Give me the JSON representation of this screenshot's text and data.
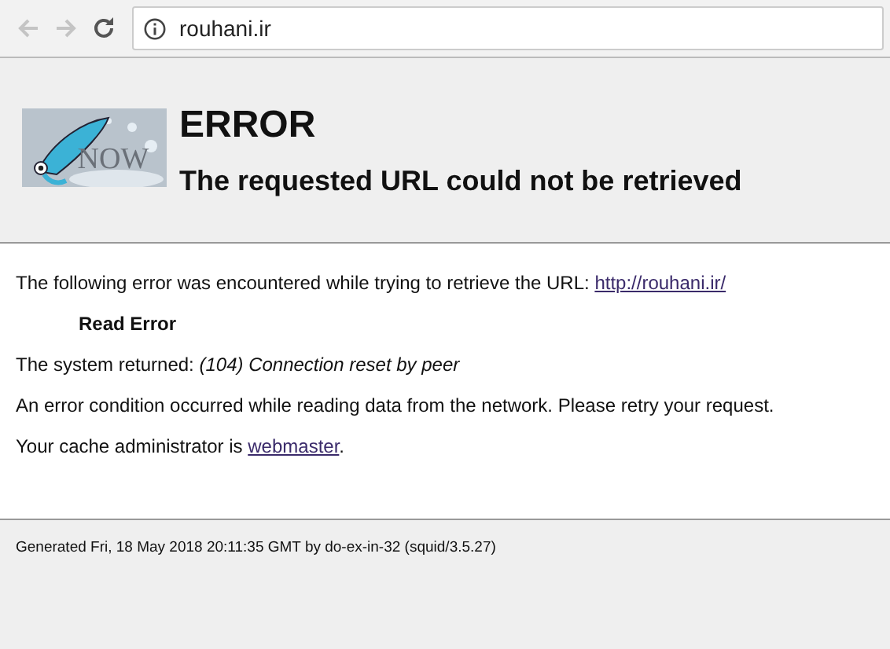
{
  "browser": {
    "nav_buttons": [
      {
        "kind": "back",
        "disabled": true
      },
      {
        "kind": "forward",
        "disabled": true
      },
      {
        "kind": "reload",
        "disabled": false
      }
    ],
    "address": "rouhani.ir"
  },
  "header": {
    "logo_text": "NOW",
    "title": "ERROR",
    "subtitle": "The requested URL could not be retrieved"
  },
  "body": [
    {
      "kind": "text",
      "text": "The following error was encountered while trying to retrieve the URL: ",
      "link": "http://rouhani.ir/"
    },
    {
      "kind": "heading",
      "text": "Read Error"
    },
    {
      "kind": "text",
      "text": "The system returned: *(104) Connection reset by peer*"
    },
    {
      "kind": "text",
      "text": "An error condition occurred while reading data from the network. Please retry your request."
    },
    {
      "kind": "text",
      "text": "Your cache administrator is ",
      "link": "webmaster",
      "suffix": "."
    }
  ],
  "footer": "Generated Fri, 18 May 2018 20:11:35 GMT by do-ex-in-32 (squid/3.5.27)"
}
